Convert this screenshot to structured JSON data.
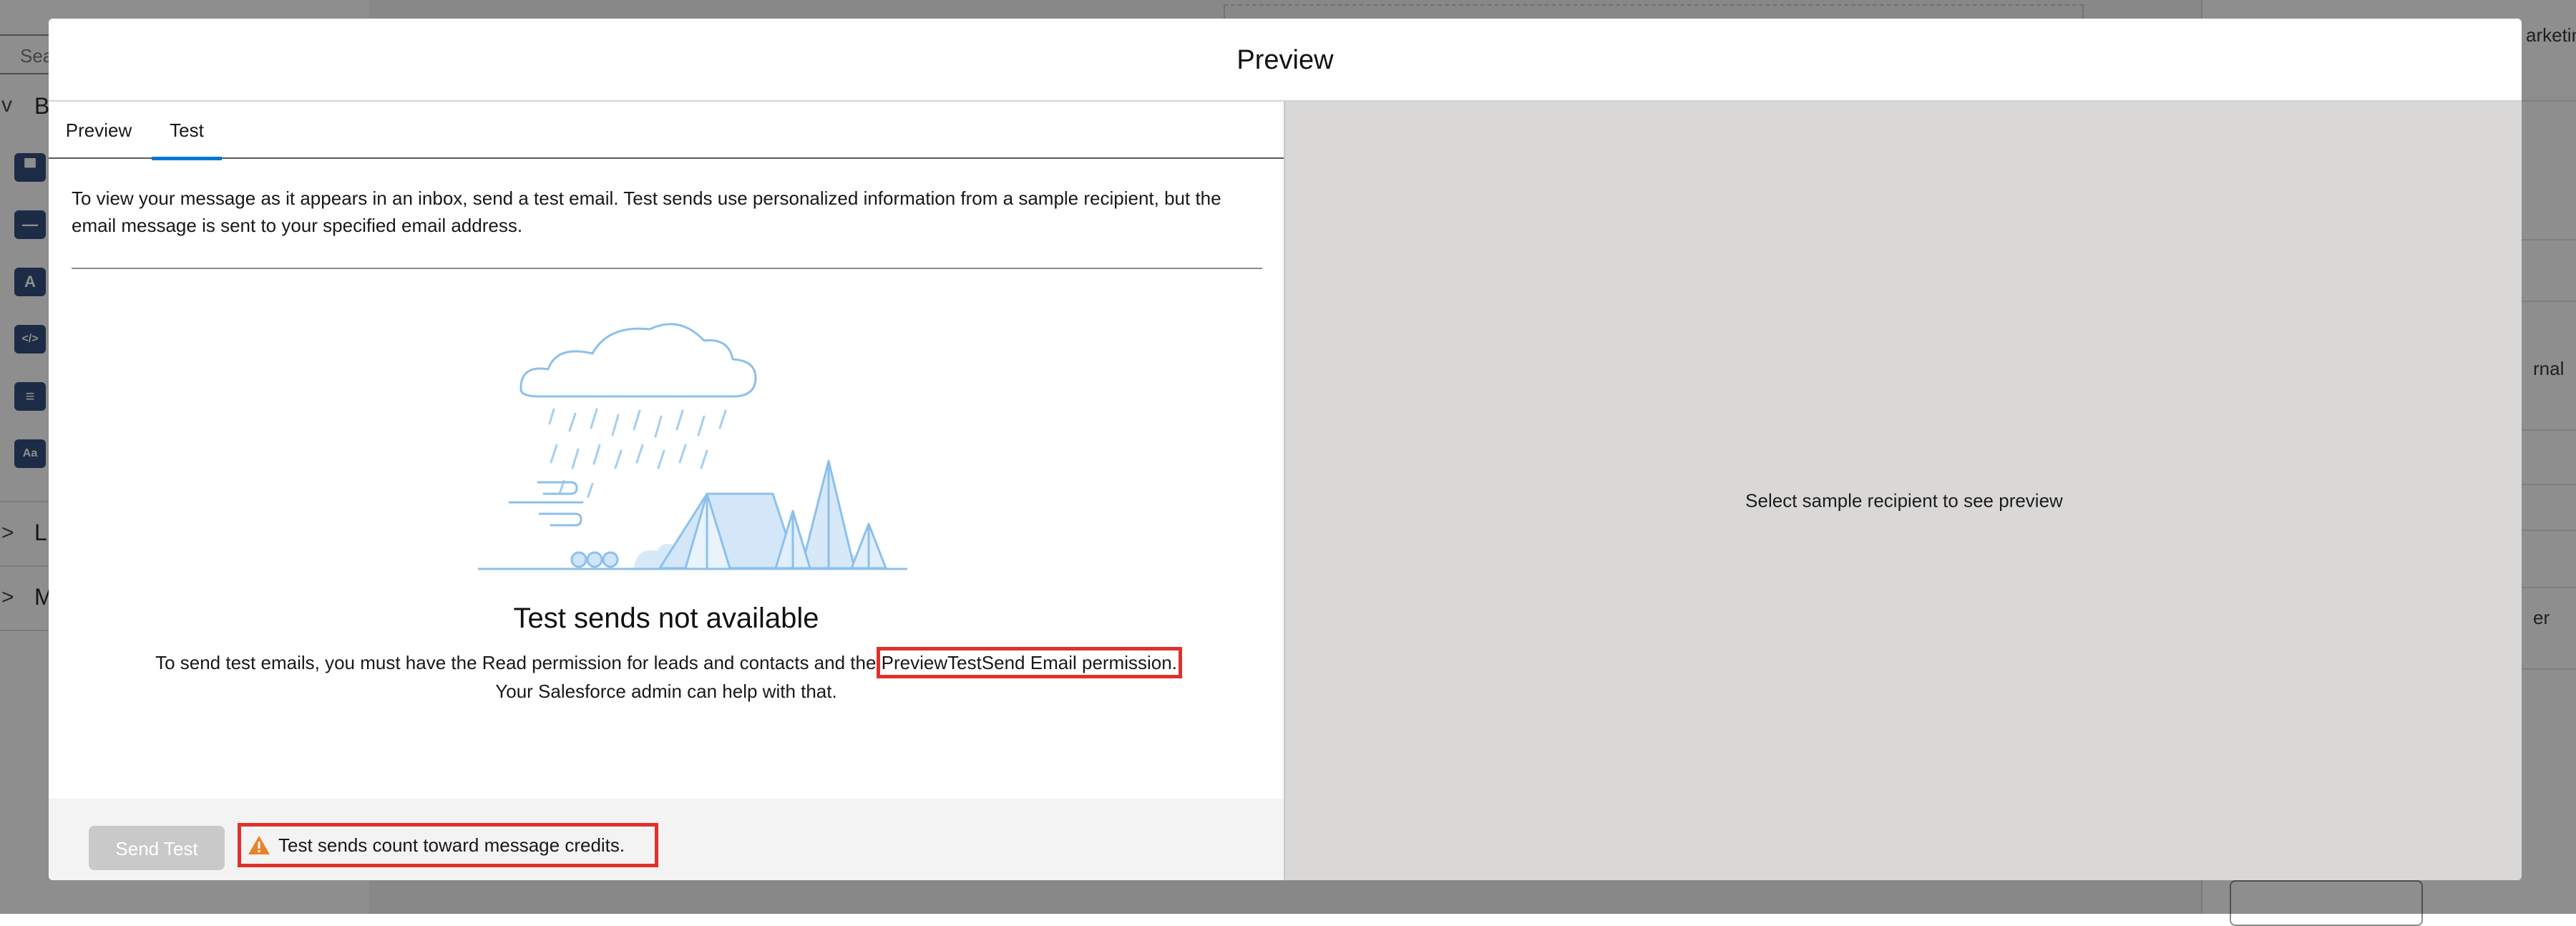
{
  "background": {
    "search_placeholder": "Sea",
    "sections": [
      {
        "chevron": "v",
        "letter": "B"
      },
      {
        "chevron": ">",
        "letter": "L"
      },
      {
        "chevron": ">",
        "letter": "M"
      }
    ],
    "tiles": [
      "▀",
      "—",
      "A",
      "</>",
      "≡",
      "Aa"
    ],
    "right_fragments": [
      "arketin",
      "rnal",
      "er"
    ]
  },
  "modal": {
    "title": "Preview",
    "tabs": [
      {
        "label": "Preview",
        "active": false
      },
      {
        "label": "Test",
        "active": true
      }
    ],
    "intro_text": "To view your message as it appears in an inbox, send a test email. Test sends use personalized information from a sample recipient, but the email message is sent to your specified email address.",
    "empty_state": {
      "illustration": "rain-cloud-tent-illustration",
      "heading": "Test sends not available",
      "body_before": "To send test emails, you must have the Read permission for leads and contacts and the ",
      "body_highlight": "PreviewTestSend Email permission.",
      "body_after": " Your Salesforce admin can help with that."
    },
    "footer": {
      "send_button": "Send Test",
      "warning_text": "Test sends count toward message credits.",
      "warning_icon": "warning-triangle-icon"
    },
    "preview_pane_message": "Select sample recipient to see preview"
  },
  "colors": {
    "highlight_box": "#e0312b",
    "tab_active": "#0176d3",
    "preview_pane_bg": "#d9d8d7",
    "warning_icon": "#e8832b",
    "illustration_stroke": "#8cc0ec"
  }
}
